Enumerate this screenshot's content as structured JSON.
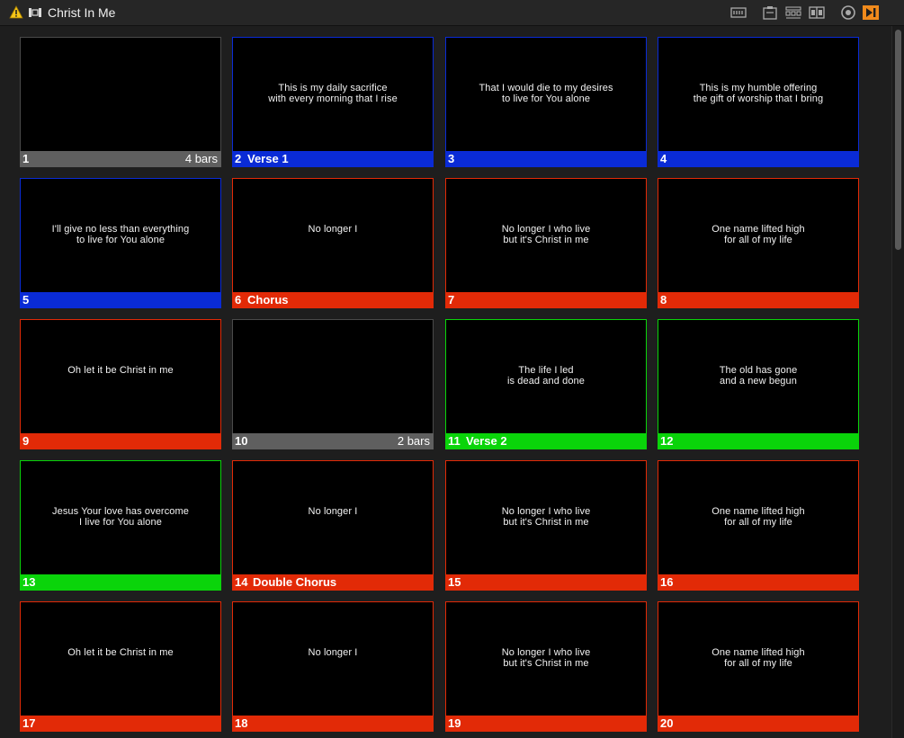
{
  "window": {
    "title": "Christ In Me"
  },
  "colors": {
    "gray": "#5f5f5f",
    "blue": "#0a2bd6",
    "red": "#e22a07",
    "green": "#0ad40a"
  },
  "toolbar_icons": [
    "timeline-icon",
    "clipboard-icon",
    "queue-icon",
    "layout-icon",
    "target-icon",
    "play-next-icon"
  ],
  "slides": [
    {
      "num": "1",
      "label": "",
      "meta": "4 bars",
      "text": "",
      "color": "gray"
    },
    {
      "num": "2",
      "label": "Verse 1",
      "meta": "",
      "text": "This is my daily sacrifice\nwith every morning that I rise",
      "color": "blue"
    },
    {
      "num": "3",
      "label": "",
      "meta": "",
      "text": "That I would die to my desires\nto live for You alone",
      "color": "blue"
    },
    {
      "num": "4",
      "label": "",
      "meta": "",
      "text": "This is my humble offering\nthe gift of worship that I bring",
      "color": "blue"
    },
    {
      "num": "5",
      "label": "",
      "meta": "",
      "text": "I'll give no less than everything\nto live for You alone",
      "color": "blue"
    },
    {
      "num": "6",
      "label": "Chorus",
      "meta": "",
      "text": "No longer I",
      "color": "red"
    },
    {
      "num": "7",
      "label": "",
      "meta": "",
      "text": "No longer I who live\nbut it's Christ in me",
      "color": "red"
    },
    {
      "num": "8",
      "label": "",
      "meta": "",
      "text": "One name lifted high\nfor all of my life",
      "color": "red"
    },
    {
      "num": "9",
      "label": "",
      "meta": "",
      "text": "Oh let it be Christ in me",
      "color": "red"
    },
    {
      "num": "10",
      "label": "",
      "meta": "2 bars",
      "text": "",
      "color": "gray"
    },
    {
      "num": "11",
      "label": "Verse 2",
      "meta": "",
      "text": "The life I led\nis dead and done",
      "color": "green"
    },
    {
      "num": "12",
      "label": "",
      "meta": "",
      "text": "The old has gone\nand a new begun",
      "color": "green"
    },
    {
      "num": "13",
      "label": "",
      "meta": "",
      "text": "Jesus Your love has overcome\nI live for You alone",
      "color": "green"
    },
    {
      "num": "14",
      "label": "Double Chorus",
      "meta": "",
      "text": "No longer I",
      "color": "red"
    },
    {
      "num": "15",
      "label": "",
      "meta": "",
      "text": "No longer I who live\nbut it's Christ in me",
      "color": "red"
    },
    {
      "num": "16",
      "label": "",
      "meta": "",
      "text": "One name lifted high\nfor all of my life",
      "color": "red"
    },
    {
      "num": "17",
      "label": "",
      "meta": "",
      "text": "Oh let it be Christ in me",
      "color": "red"
    },
    {
      "num": "18",
      "label": "",
      "meta": "",
      "text": "No longer I",
      "color": "red"
    },
    {
      "num": "19",
      "label": "",
      "meta": "",
      "text": "No longer I who live\nbut it's Christ in me",
      "color": "red"
    },
    {
      "num": "20",
      "label": "",
      "meta": "",
      "text": "One name lifted high\nfor all of my life",
      "color": "red"
    }
  ]
}
